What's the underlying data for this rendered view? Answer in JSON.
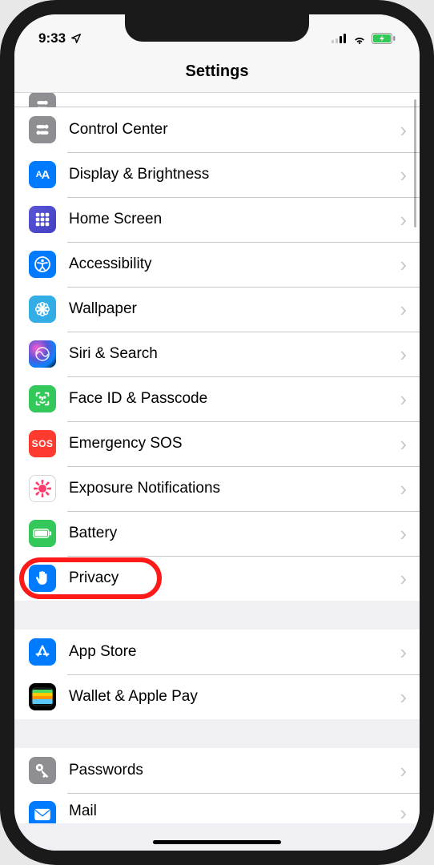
{
  "status": {
    "time": "9:33",
    "location_icon": "location-arrow",
    "battery_charging": true
  },
  "header": {
    "title": "Settings"
  },
  "groups": [
    {
      "partial_above": {
        "icon": "control-center-partial"
      },
      "rows": [
        {
          "id": "control-center",
          "label": "Control Center",
          "icon": "toggles",
          "bg": "bg-gray"
        },
        {
          "id": "display-brightness",
          "label": "Display & Brightness",
          "icon": "aa",
          "bg": "bg-blue"
        },
        {
          "id": "home-screen",
          "label": "Home Screen",
          "icon": "grid",
          "bg": "bg-indigo"
        },
        {
          "id": "accessibility",
          "label": "Accessibility",
          "icon": "person-circle",
          "bg": "bg-blue"
        },
        {
          "id": "wallpaper",
          "label": "Wallpaper",
          "icon": "flower",
          "bg": "bg-cyan"
        },
        {
          "id": "siri-search",
          "label": "Siri & Search",
          "icon": "siri",
          "bg": "bg-siri"
        },
        {
          "id": "face-id-passcode",
          "label": "Face ID & Passcode",
          "icon": "face",
          "bg": "bg-green"
        },
        {
          "id": "emergency-sos",
          "label": "Emergency SOS",
          "icon": "sos",
          "bg": "bg-red"
        },
        {
          "id": "exposure-notifications",
          "label": "Exposure Notifications",
          "icon": "covid",
          "bg": "bg-white"
        },
        {
          "id": "battery",
          "label": "Battery",
          "icon": "battery",
          "bg": "bg-green"
        },
        {
          "id": "privacy",
          "label": "Privacy",
          "icon": "hand",
          "bg": "bg-blue",
          "highlighted": true
        }
      ]
    },
    {
      "rows": [
        {
          "id": "app-store",
          "label": "App Store",
          "icon": "appstore",
          "bg": "bg-blue"
        },
        {
          "id": "wallet-apple-pay",
          "label": "Wallet & Apple Pay",
          "icon": "wallet",
          "bg": "bg-black"
        }
      ]
    },
    {
      "rows": [
        {
          "id": "passwords",
          "label": "Passwords",
          "icon": "key",
          "bg": "bg-gray"
        },
        {
          "id": "mail",
          "label": "Mail",
          "icon": "mail",
          "bg": "bg-blue",
          "cut": true
        }
      ]
    }
  ]
}
